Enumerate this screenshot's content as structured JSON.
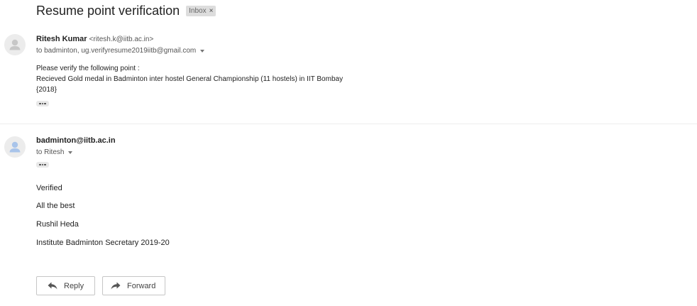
{
  "thread": {
    "subject": "Resume point verification",
    "label": "Inbox",
    "label_remove": "×"
  },
  "message1": {
    "sender_name": "Ritesh Kumar",
    "sender_email": "<ritesh.k@iitb.ac.in>",
    "recipients": "to badminton, ug.verifyresume2019iitb@gmail.com",
    "body_lines": [
      "Please verify the following point :",
      "Recieved Gold medal in Badminton inter hostel General Championship (11 hostels) in IIT Bombay",
      "{2018}"
    ]
  },
  "message2": {
    "sender_name": "badminton@iitb.ac.in",
    "recipients": "to Ritesh",
    "body_lines": [
      "Verified",
      "All the best",
      "Rushil Heda",
      "Institute Badminton Secretary 2019-20"
    ]
  },
  "actions": {
    "reply_label": "Reply",
    "forward_label": "Forward"
  },
  "colors": {
    "avatar_bg": "#ececec",
    "avatar_fg": "#c7c7c7",
    "avatar_blue": "#a9c4ea",
    "chip_bg": "#dddddd"
  },
  "icons": [
    "person-icon",
    "caret-down-icon",
    "reply-icon",
    "forward-icon",
    "more-dots-icon",
    "close-icon"
  ]
}
